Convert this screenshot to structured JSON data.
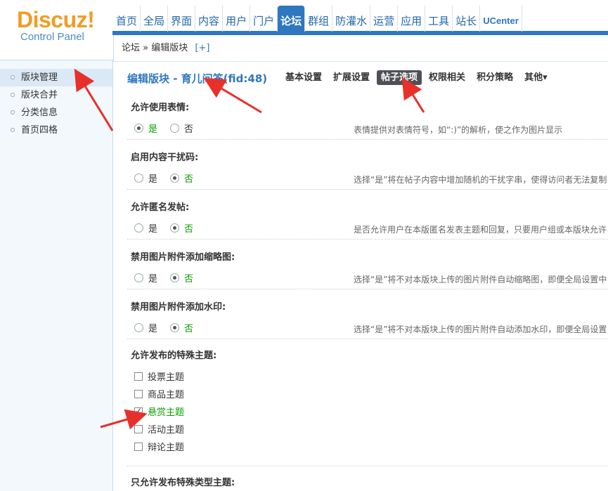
{
  "logo": {
    "main": "Discuz!",
    "sub": "Control Panel"
  },
  "topnav": [
    {
      "label": "首页"
    },
    {
      "label": "全局"
    },
    {
      "label": "界面"
    },
    {
      "label": "内容"
    },
    {
      "label": "用户"
    },
    {
      "label": "门户"
    },
    {
      "label": "论坛"
    },
    {
      "label": "群组"
    },
    {
      "label": "防灌水"
    },
    {
      "label": "运营"
    },
    {
      "label": "应用"
    },
    {
      "label": "工具"
    },
    {
      "label": "站长"
    },
    {
      "label": "UCenter"
    }
  ],
  "topnav_active": "论坛",
  "breadcrumb": {
    "root": "论坛",
    "sep": "»",
    "current": "编辑版块",
    "plus": "[+]"
  },
  "sidebar": {
    "items": [
      {
        "label": "版块管理"
      },
      {
        "label": "版块合并"
      },
      {
        "label": "分类信息"
      },
      {
        "label": "首页四格"
      }
    ]
  },
  "main": {
    "title": "编辑版块 - 育儿问答(fid:48)",
    "tabs": [
      {
        "label": "基本设置"
      },
      {
        "label": "扩展设置"
      },
      {
        "label": "帖子选项"
      },
      {
        "label": "权限相关"
      },
      {
        "label": "积分策略"
      },
      {
        "label": "其他▾"
      }
    ],
    "active_tab": "帖子选项",
    "yes_label": "是",
    "no_label": "否",
    "sections": [
      {
        "label": "允许使用表情:",
        "value": "yes",
        "desc": "表情提供对表情符号，如“:)”的解析，使之作为图片显示"
      },
      {
        "label": "启用内容干扰码:",
        "value": "no",
        "desc": "选择“是”将在帖子内容中增加随机的干扰字串，使得访问者无法复制"
      },
      {
        "label": "允许匿名发帖:",
        "value": "no",
        "desc": "是否允许用户在本版匿名发表主题和回复，只要用户组或本版块允许"
      },
      {
        "label": "禁用图片附件添加缩略图:",
        "value": "no",
        "desc": "选择“是”将不对本版块上传的图片附件自动缩略图，即便全局设置中"
      },
      {
        "label": "禁用图片附件添加水印:",
        "value": "no",
        "desc": "选择“是”将不对本版块上传的图片附件自动添加水印，即便全局设置"
      }
    ],
    "special_label": "允许发布的特殊主题:",
    "special_options": [
      {
        "label": "投票主题",
        "checked": false
      },
      {
        "label": "商品主题",
        "checked": false
      },
      {
        "label": "悬赏主题",
        "checked": true
      },
      {
        "label": "活动主题",
        "checked": false
      },
      {
        "label": "辩论主题",
        "checked": false
      }
    ],
    "only_special_label": "只允许发布特殊类型主题:"
  },
  "colors": {
    "brand_orange": "#f29b24",
    "nav_blue": "#2f77c0",
    "selected_green": "#09a000",
    "arrow_red": "#e8302a"
  }
}
